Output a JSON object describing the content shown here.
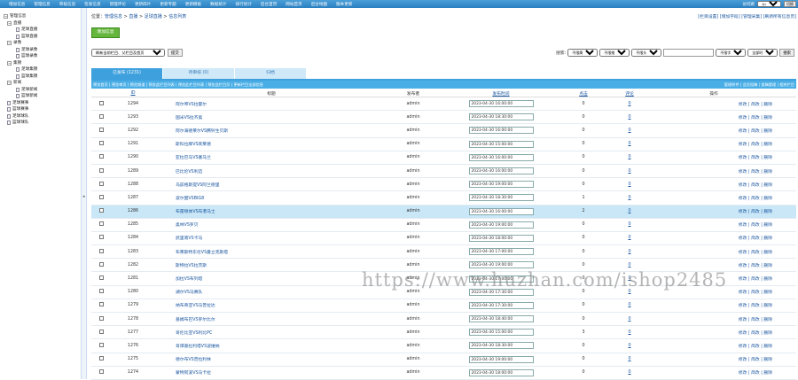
{
  "topbar": {
    "menu": [
      "增加信息",
      "管理信息",
      "审核信息",
      "签发信息",
      "管理评论",
      "更新碎片",
      "更新专题",
      "更新模板",
      "数据统计",
      "排行统计",
      "后台首页",
      "网站首页",
      "后台地图",
      "版本更新"
    ],
    "status_label": "访问路",
    "select_value": "主频道模式",
    "button_label": "切换"
  },
  "sidebar": {
    "root": "管理信息",
    "nodes": [
      {
        "label": "直播",
        "level": 1,
        "type": "folder"
      },
      {
        "label": "足球直播",
        "level": 2,
        "type": "file"
      },
      {
        "label": "篮球直播",
        "level": 2,
        "type": "file"
      },
      {
        "label": "录像",
        "level": 1,
        "type": "folder"
      },
      {
        "label": "足球录像",
        "level": 2,
        "type": "file"
      },
      {
        "label": "篮球录像",
        "level": 2,
        "type": "file"
      },
      {
        "label": "集锦",
        "level": 1,
        "type": "folder"
      },
      {
        "label": "足球集锦",
        "level": 2,
        "type": "file"
      },
      {
        "label": "篮球集锦",
        "level": 2,
        "type": "file"
      },
      {
        "label": "新闻",
        "level": 1,
        "type": "folder"
      },
      {
        "label": "足球新闻",
        "level": 2,
        "type": "file"
      },
      {
        "label": "篮球新闻",
        "level": 2,
        "type": "file"
      },
      {
        "label": "足球赛事",
        "level": 1,
        "type": "file"
      },
      {
        "label": "篮球赛事",
        "level": 1,
        "type": "file"
      },
      {
        "label": "足球球队",
        "level": 1,
        "type": "file"
      },
      {
        "label": "篮球球队",
        "level": 1,
        "type": "file"
      }
    ]
  },
  "breadcrumb": {
    "prefix": "位置：",
    "items": [
      "管理信息",
      "直播",
      "足球直播",
      "信息列表"
    ],
    "sep": " > "
  },
  "toplinks": "[栏目设置] [增加字段] [管理采集] [刷新所有信息页]",
  "add_button": "增加信息",
  "filter": {
    "left_select": "刷新当前栏目、父栏目及首页",
    "left_button": "提交",
    "search_label": "搜索:",
    "sel1": "不限属性",
    "sel2": "不限推荐",
    "sel3": "不限头条",
    "input_value": "",
    "sel4": "不限字段",
    "sel5": "全部时间",
    "search_button": "搜索"
  },
  "tabs": [
    {
      "label": "已发布 (1231)",
      "active": true
    },
    {
      "label": "待审核 (0)",
      "active": false
    },
    {
      "label": "归档",
      "active": false
    }
  ],
  "toolbar": {
    "left": "预览首页 | 预览审页 | 预览频道 | 预览此栏目列表 | 预览此栏目列表 | 预览此栏目页 | 更新栏目全部信息",
    "right": "管理附件 | 会员投稿 | 投稿管理 | 相关栏目"
  },
  "grid_header": {
    "id": "ID",
    "title": "标题",
    "author": "发布者",
    "time": "发布时间",
    "click": "点击",
    "comment": "评论",
    "ops": "操作"
  },
  "rows": [
    {
      "id": "1294",
      "title": "阿尔帝VS拉霍尔",
      "author": "admin",
      "time": "2023-04-30 16:00:00",
      "click": "0",
      "comment": "0",
      "ops": "修改 | 简改 | 删除",
      "highlight": false
    },
    {
      "id": "1293",
      "title": "国米VS拉齐奥",
      "author": "admin",
      "time": "2023-04-30 18:30:00",
      "click": "0",
      "comment": "0",
      "ops": "修改 | 简改 | 删除",
      "highlight": false
    },
    {
      "id": "1292",
      "title": "阿尔海德莱尔VS腾铃生贝斯",
      "author": "admin",
      "time": "2023-04-30 16:00:00",
      "click": "0",
      "comment": "0",
      "ops": "修改 | 简改 | 删除",
      "highlight": false
    },
    {
      "id": "1291",
      "title": "斯科拉摩VS宾莱德",
      "author": "admin",
      "time": "2023-04-30 15:00:00",
      "click": "0",
      "comment": "0",
      "ops": "修改 | 简改 | 删除",
      "highlight": false
    },
    {
      "id": "1290",
      "title": "亚拉巴马VS塞马兰",
      "author": "admin",
      "time": "2023-04-30 16:00:00",
      "click": "0",
      "comment": "0",
      "ops": "修改 | 简改 | 删除",
      "highlight": false
    },
    {
      "id": "1289",
      "title": "巴比伦VS利迈",
      "author": "admin",
      "time": "2023-04-30 16:00:00",
      "click": "0",
      "comment": "0",
      "ops": "修改 | 简改 | 删除",
      "highlight": false
    },
    {
      "id": "1288",
      "title": "乌兹格斯提VS阿兰德里",
      "author": "admin",
      "time": "2023-04-30 19:00:00",
      "click": "0",
      "comment": "0",
      "ops": "修改 | 简改 | 删除",
      "highlight": false
    },
    {
      "id": "1287",
      "title": "波尔图VSBIG8",
      "author": "admin",
      "time": "2023-04-30 18:30:00",
      "click": "1",
      "comment": "0",
      "ops": "修改 | 简改 | 删除",
      "highlight": false
    },
    {
      "id": "1286",
      "title": "布雷顿体VS布港马士",
      "author": "admin",
      "time": "2023-04-30 16:00:00",
      "click": "2",
      "comment": "0",
      "ops": "修改 | 简改 | 删除",
      "highlight": true
    },
    {
      "id": "1285",
      "title": "奥林VS罗贝",
      "author": "admin",
      "time": "2023-04-30 19:00:00",
      "click": "0",
      "comment": "0",
      "ops": "修改 | 简改 | 删除",
      "highlight": false
    },
    {
      "id": "1284",
      "title": "武里南VS卡马",
      "author": "admin",
      "time": "2023-04-30 18:00:00",
      "click": "0",
      "comment": "0",
      "ops": "修改 | 简改 | 删除",
      "highlight": false
    },
    {
      "id": "1283",
      "title": "布莱斯特东伦VS曼立克斯塔",
      "author": "admin",
      "time": "2023-04-30 17:00:00",
      "click": "0",
      "comment": "0",
      "ops": "修改 | 简改 | 删除",
      "highlight": false
    },
    {
      "id": "1282",
      "title": "斯特拉VS拉茨斯",
      "author": "admin",
      "time": "2023-04-30 19:00:00",
      "click": "0",
      "comment": "0",
      "ops": "修改 | 简改 | 删除",
      "highlight": false
    },
    {
      "id": "1281",
      "title": "加拉VS布列塔",
      "author": "admin",
      "time": "2023-04-30 17:00:00",
      "click": "0",
      "comment": "0",
      "ops": "修改 | 简改 | 删除",
      "highlight": false
    },
    {
      "id": "1280",
      "title": "湖尔VS马赛队",
      "author": "admin",
      "time": "2023-04-30 17:30:00",
      "click": "0",
      "comment": "0",
      "ops": "修改 | 简改 | 删除",
      "highlight": false
    },
    {
      "id": "1279",
      "title": "纳布蒂亚VS马普拉达",
      "author": "admin",
      "time": "2023-04-30 17:30:00",
      "click": "0",
      "comment": "0",
      "ops": "修改 | 简改 | 删除",
      "highlight": false
    },
    {
      "id": "1278",
      "title": "基姆布巴VS罗尔比尔",
      "author": "admin",
      "time": "2023-04-30 18:40:00",
      "click": "0",
      "comment": "0",
      "ops": "修改 | 简改 | 删除",
      "highlight": false
    },
    {
      "id": "1277",
      "title": "哥伦比亚VS利比PC",
      "author": "admin",
      "time": "2023-04-30 15:00:00",
      "click": "3",
      "comment": "0",
      "ops": "修改 | 简改 | 删除",
      "highlight": false
    },
    {
      "id": "1276",
      "title": "哥谭基拉利塔VS波维纳",
      "author": "admin",
      "time": "2023-04-30 18:30:00",
      "click": "0",
      "comment": "0",
      "ops": "修改 | 简改 | 删除",
      "highlight": false
    },
    {
      "id": "1275",
      "title": "德尔布VS普拉利林",
      "author": "admin",
      "time": "2023-04-30 19:00:00",
      "click": "0",
      "comment": "0",
      "ops": "修改 | 简改 | 删除",
      "highlight": false
    },
    {
      "id": "1274",
      "title": "蒙特阿波VS马卡拉",
      "author": "admin",
      "time": "2023-04-30 18:00:00",
      "click": "0",
      "comment": "0",
      "ops": "修改 | 简改 | 删除",
      "highlight": false
    }
  ],
  "watermark": "https://www.huzhan.com/ishop2485"
}
